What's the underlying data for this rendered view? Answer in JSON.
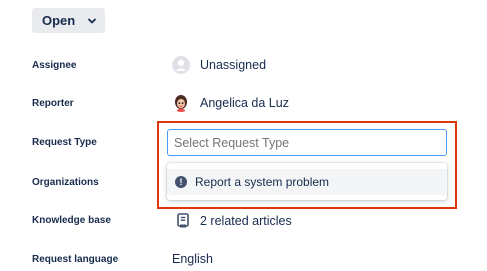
{
  "status": {
    "label": "Open",
    "icon": "chevron-down-icon"
  },
  "fields": {
    "assignee": {
      "label": "Assignee",
      "value": "Unassigned",
      "icon": "avatar-placeholder-icon"
    },
    "reporter": {
      "label": "Reporter",
      "value": "Angelica da Luz",
      "icon": "user-avatar"
    },
    "request_type": {
      "label": "Request Type",
      "placeholder": "Select Request Type"
    },
    "organizations": {
      "label": "Organizations"
    },
    "knowledge_base": {
      "label": "Knowledge base",
      "value": "2 related articles",
      "icon": "book-icon"
    },
    "request_language": {
      "label": "Request language",
      "value": "English"
    }
  },
  "dropdown": {
    "options": [
      {
        "label": "Report a system problem",
        "icon": "info-circle-icon"
      }
    ]
  },
  "colors": {
    "highlight_border": "#de350b",
    "input_focus_border": "#4c9aff",
    "status_button_bg": "#e9ebee",
    "text_primary": "#172b4d"
  }
}
